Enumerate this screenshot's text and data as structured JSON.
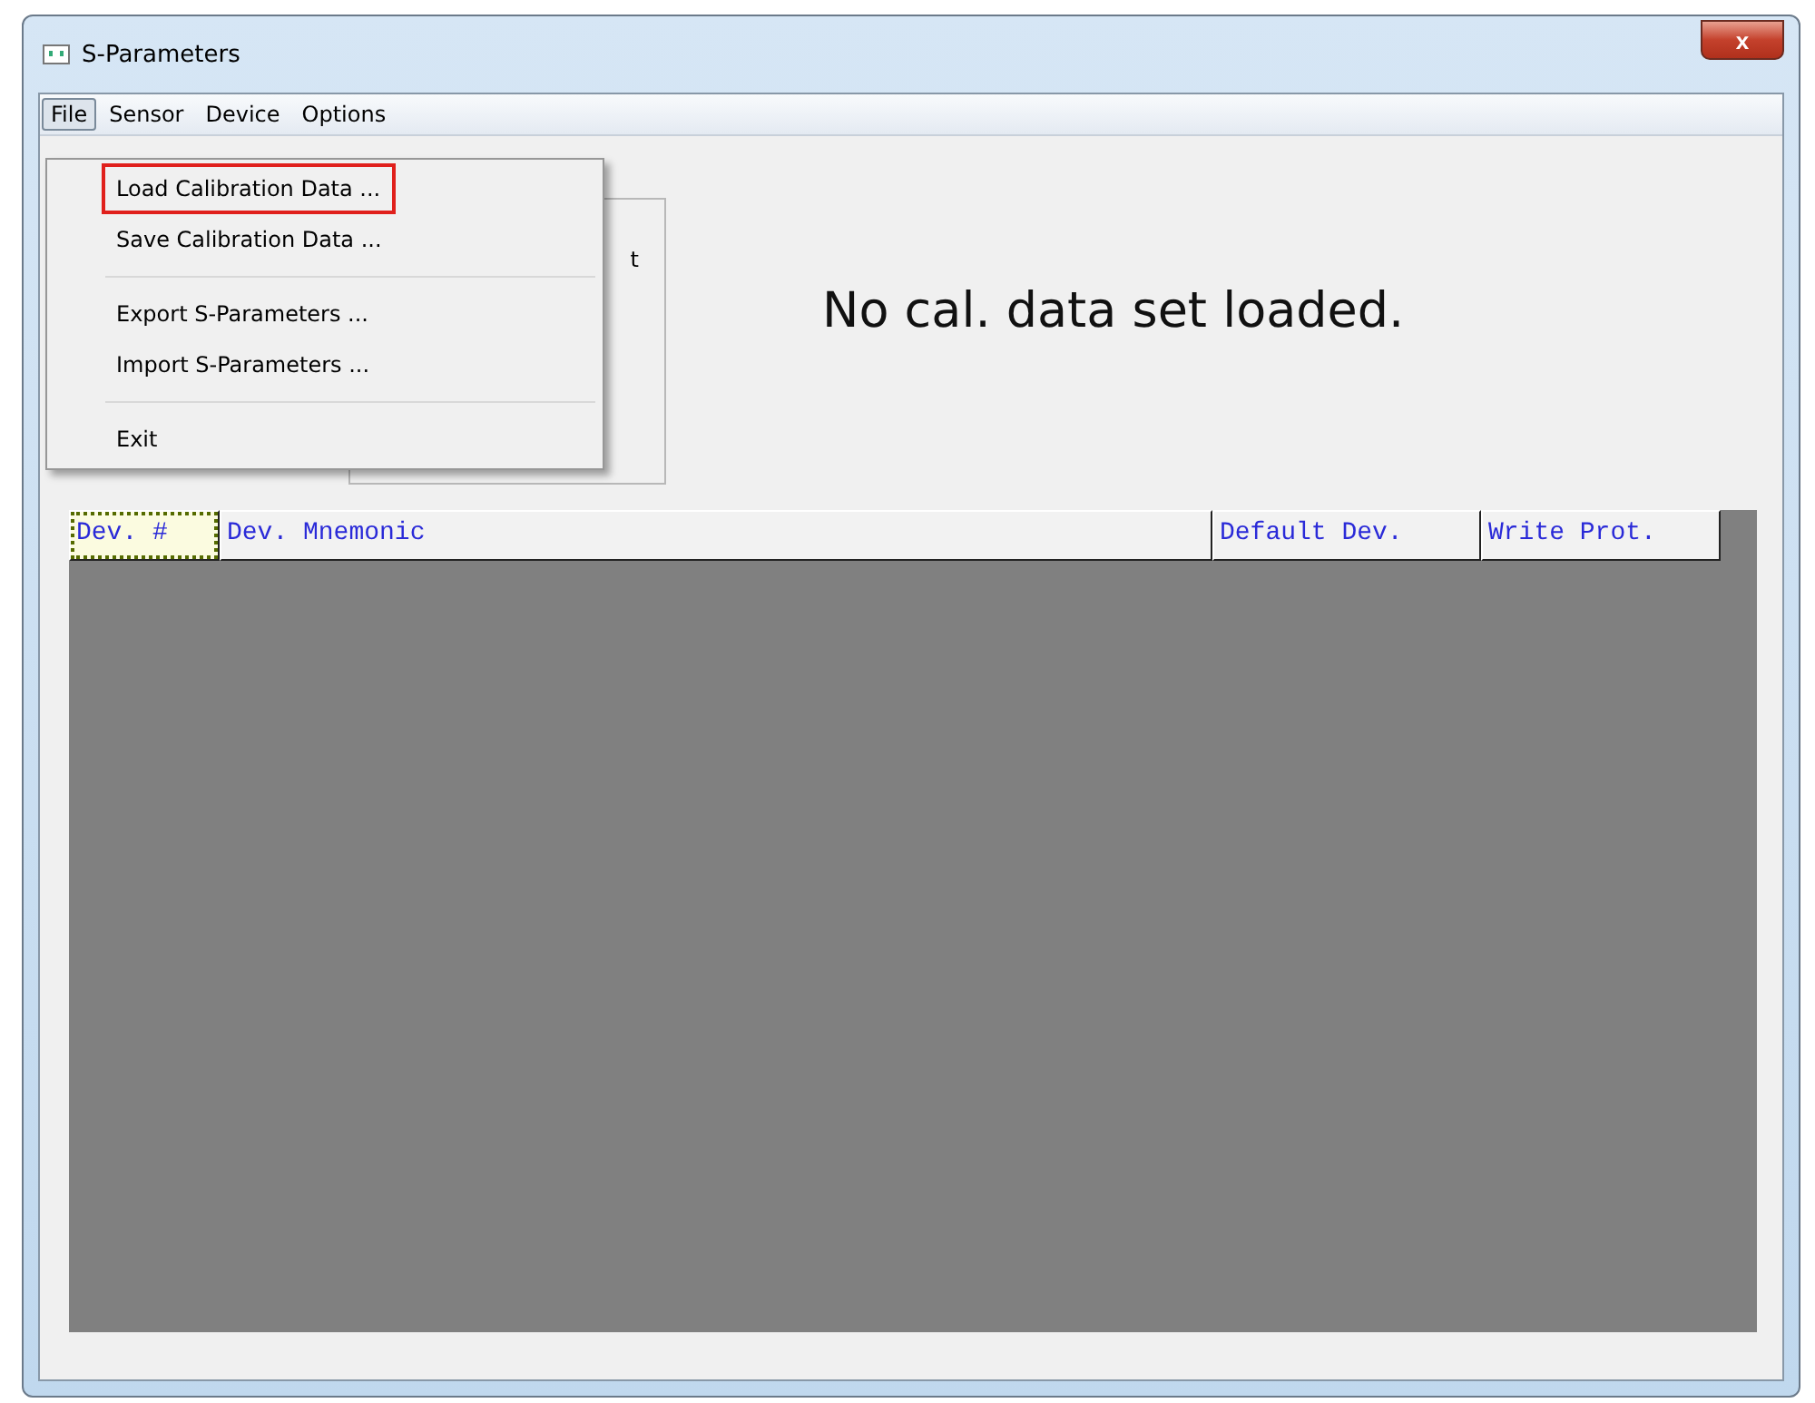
{
  "window": {
    "title": "S-Parameters",
    "close_label": "x"
  },
  "menu_bar": [
    {
      "label": "File",
      "selected": true
    },
    {
      "label": "Sensor",
      "selected": false
    },
    {
      "label": "Device",
      "selected": false
    },
    {
      "label": "Options",
      "selected": false
    }
  ],
  "file_menu": [
    {
      "kind": "item",
      "label": "Load Calibration Data ...",
      "highlighted": true
    },
    {
      "kind": "item",
      "label": "Save Calibration Data ...",
      "highlighted": false
    },
    {
      "kind": "separator"
    },
    {
      "kind": "item",
      "label": "Export S-Parameters ...",
      "highlighted": false
    },
    {
      "kind": "item",
      "label": "Import S-Parameters ...",
      "highlighted": false
    },
    {
      "kind": "separator"
    },
    {
      "kind": "item",
      "label": "Exit",
      "highlighted": false
    }
  ],
  "group_box": {
    "visible_text": "t"
  },
  "status_message": "No cal. data set loaded.",
  "table": {
    "columns": [
      {
        "label": "Dev. #",
        "selected": true
      },
      {
        "label": "Dev. Mnemonic",
        "selected": false
      },
      {
        "label": "Default Dev.",
        "selected": false
      },
      {
        "label": "Write Prot.",
        "selected": false
      }
    ]
  }
}
